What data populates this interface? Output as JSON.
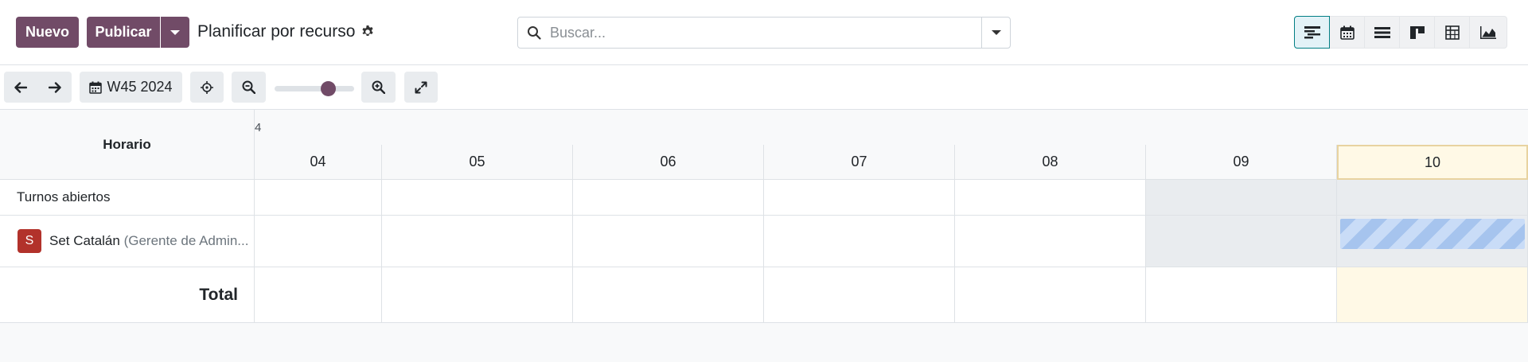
{
  "control_panel": {
    "new_label": "Nuevo",
    "publish_label": "Publicar",
    "breadcrumb": "Planificar por recurso",
    "search": {
      "placeholder": "Buscar..."
    },
    "views": [
      "gantt-icon",
      "calendar-icon",
      "list-icon",
      "kanban-icon",
      "pivot-icon",
      "graph-icon"
    ],
    "active_view": "gantt-icon"
  },
  "toolbar": {
    "date_label": "W45 2024",
    "zoom_level": 0.72
  },
  "gantt": {
    "header_label": "Horario",
    "top_label": "4",
    "days": [
      "04",
      "05",
      "06",
      "07",
      "08",
      "09",
      "10"
    ],
    "today": "10",
    "weekend_days": [
      "09",
      "10"
    ],
    "rows": [
      {
        "label": "Turnos abiertos"
      },
      {
        "avatar_letter": "S",
        "name": "Set Catalán",
        "role": "(Gerente de Admin..."
      }
    ],
    "total_label": "Total",
    "accent": "#714b67"
  }
}
